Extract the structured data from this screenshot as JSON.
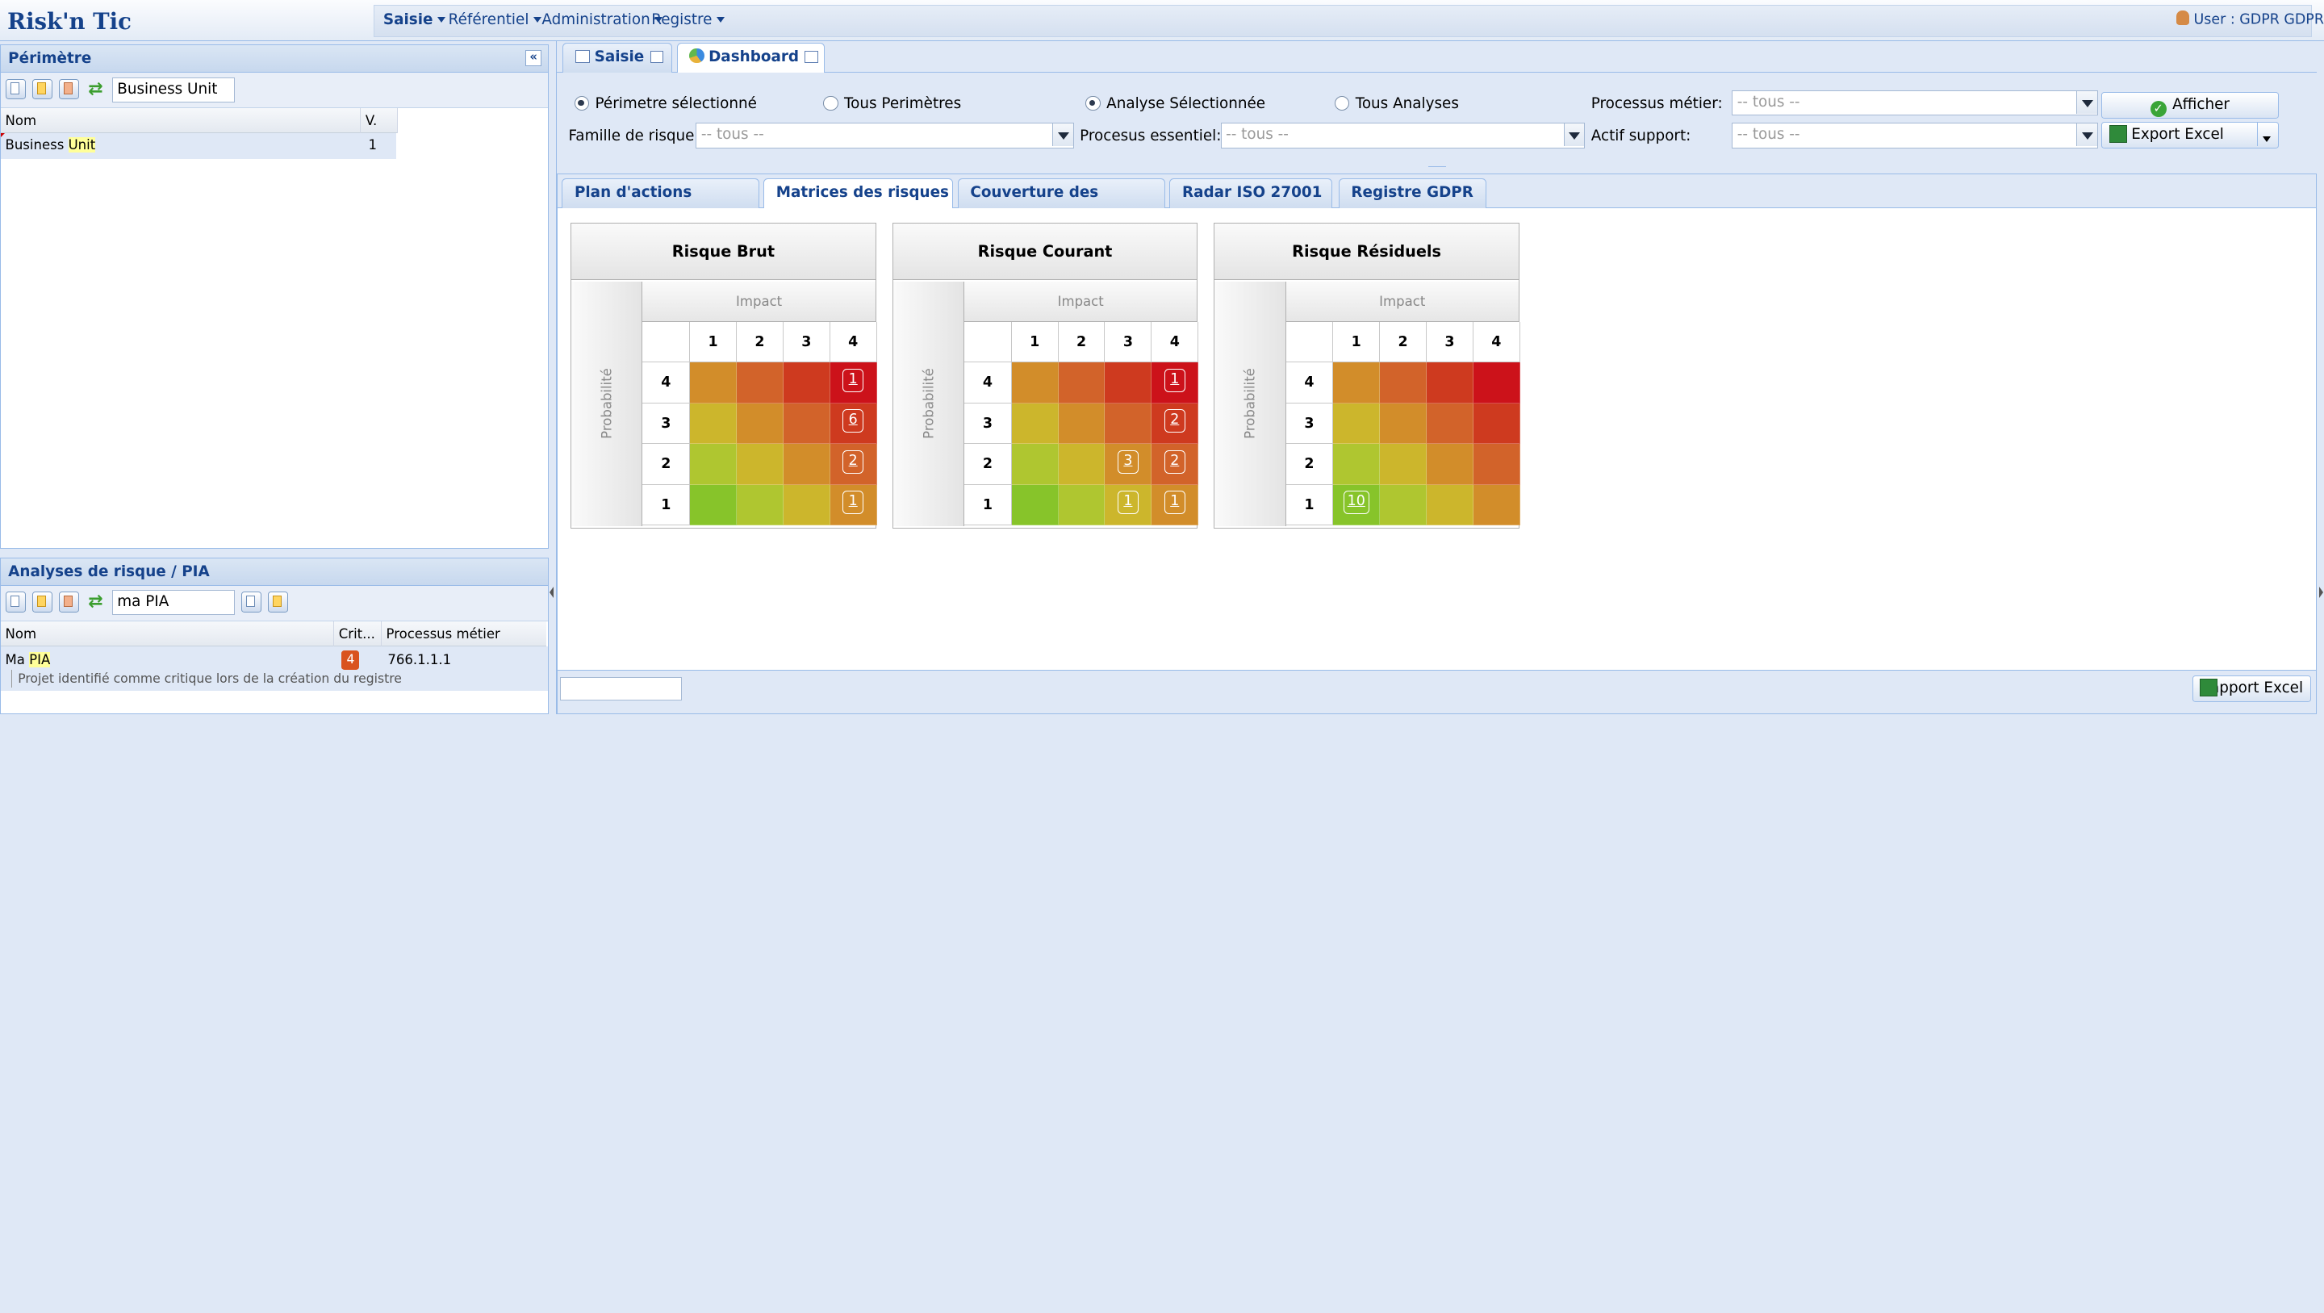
{
  "app": {
    "title": "Risk'n Tic",
    "user": "User : GDPR GDPR"
  },
  "menu": [
    {
      "label": "Saisie",
      "bold": true
    },
    {
      "label": "Référentiel"
    },
    {
      "label": "Administration"
    },
    {
      "label": "Registre"
    }
  ],
  "perimetre": {
    "title": "Périmètre",
    "search_value": "Business Unit",
    "columns": [
      "Nom",
      "V."
    ],
    "rows": [
      {
        "name_plain": "Business ",
        "name_hl": "Unit",
        "v": "1"
      }
    ]
  },
  "analyses": {
    "title": "Analyses de risque / PIA",
    "search_value": "ma PIA",
    "columns": [
      "Nom",
      "Crit...",
      "Processus métier"
    ],
    "rows": [
      {
        "name_plain": "Ma ",
        "name_hl": "PIA",
        "crit": "4",
        "process": "766.1.1.1",
        "desc": "Projet identifié comme critique lors de la création du registre"
      }
    ]
  },
  "main_tabs": [
    "Saisie",
    "Dashboard"
  ],
  "filters": {
    "radio_perimetre_sel": "Périmetre sélectionné",
    "radio_tous_perimetres": "Tous Perimètres",
    "radio_analyse_sel": "Analyse Sélectionnée",
    "radio_tous_analyses": "Tous Analyses",
    "processus_metier_label": "Processus métier:",
    "famille_label": "Famille de risque:",
    "processus_essentiel_label": "Procesus essentiel:",
    "actif_support_label": "Actif support:",
    "placeholder": "-- tous --",
    "afficher": "Afficher",
    "export": "Export Excel"
  },
  "sub_tabs": [
    "Plan d'actions détaillé",
    "Matrices des risques",
    "Couverture des risques",
    "Radar ISO 27001",
    "Registre GDPR"
  ],
  "matrix_labels": {
    "impact": "Impact",
    "probabilite": "Probabilité",
    "impact_values": [
      "1",
      "2",
      "3",
      "4"
    ],
    "prob_values": [
      "4",
      "3",
      "2",
      "1"
    ]
  },
  "matrices": [
    {
      "title": "Risque Brut",
      "counts": [
        [
          "",
          "",
          "",
          "1"
        ],
        [
          "",
          "",
          "",
          "6"
        ],
        [
          "",
          "",
          "",
          "2"
        ],
        [
          "",
          "",
          "",
          "1"
        ]
      ]
    },
    {
      "title": "Risque Courant",
      "counts": [
        [
          "",
          "",
          "",
          "1"
        ],
        [
          "",
          "",
          "",
          "2"
        ],
        [
          "",
          "",
          "3",
          "2"
        ],
        [
          "",
          "",
          "1",
          "1"
        ]
      ]
    },
    {
      "title": "Risque Résiduels",
      "counts": [
        [
          "",
          "",
          "",
          ""
        ],
        [
          "",
          "",
          "",
          ""
        ],
        [
          "",
          "",
          "",
          ""
        ],
        [
          "10",
          "",
          "",
          ""
        ]
      ]
    }
  ],
  "heat_colors": [
    [
      "#d28d2a",
      "#d2632a",
      "#ce3a1f",
      "#cc121a"
    ],
    [
      "#ccb62c",
      "#d28d2a",
      "#d2632a",
      "#ce3a1f"
    ],
    [
      "#afc630",
      "#ccb62c",
      "#d28d2a",
      "#d2632a"
    ],
    [
      "#87c42a",
      "#afc630",
      "#ccb62c",
      "#d28d2a"
    ]
  ],
  "footer": {
    "rapport": "Rapport Excel"
  }
}
